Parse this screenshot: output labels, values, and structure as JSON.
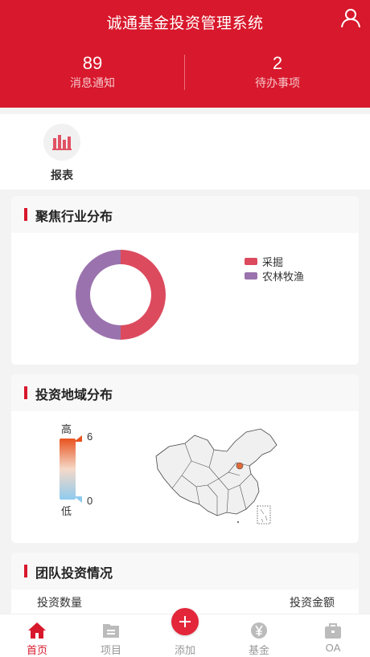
{
  "header": {
    "title": "诚通基金投资管理系统",
    "stats": [
      {
        "value": "89",
        "label": "消息通知"
      },
      {
        "value": "2",
        "label": "待办事项"
      }
    ]
  },
  "quick": {
    "items": [
      {
        "label": "报表",
        "icon": "bar-chart-icon"
      }
    ]
  },
  "industry": {
    "title": "聚焦行业分布",
    "chart_data": {
      "type": "pie",
      "categories": [
        "采掘",
        "农林牧渔"
      ],
      "values": [
        50,
        50
      ],
      "colors": [
        "#dc4a5e",
        "#9a73ae"
      ],
      "legend": "top-right"
    }
  },
  "region": {
    "title": "投资地域分布",
    "visual_map": {
      "high_label": "高",
      "low_label": "低",
      "max": "6",
      "min": "0",
      "colors": [
        "#e8531f",
        "#8fcbee"
      ]
    },
    "map_colors": {
      "region": "#f0f0f0",
      "highlight": "#e06a3a",
      "border": "#444444"
    }
  },
  "team": {
    "title": "团队投资情况",
    "left_label": "投资数量",
    "right_label": "投资金额"
  },
  "tabbar": {
    "accent": "#d8182c",
    "items": [
      {
        "label": "首页",
        "icon": "home-icon",
        "active": true
      },
      {
        "label": "项目",
        "icon": "project-icon",
        "active": false
      },
      {
        "label": "添加",
        "icon": "add-icon",
        "active": false
      },
      {
        "label": "基金",
        "icon": "yen-icon",
        "active": false
      },
      {
        "label": "OA",
        "icon": "briefcase-icon",
        "active": false
      }
    ]
  }
}
